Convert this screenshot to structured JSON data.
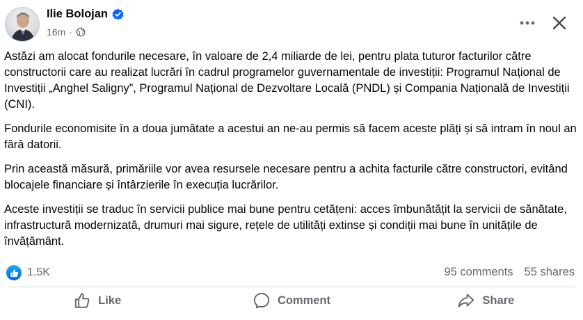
{
  "post": {
    "author": "Ilie Bolojan",
    "time": "16m",
    "icons": {
      "verified": "verified-badge-icon",
      "audience": "globe-icon",
      "more": "more-horizontal-icon",
      "close": "close-icon"
    },
    "paragraphs": [
      "Astăzi am alocat fondurile necesare, în valoare de 2,4 miliarde de lei, pentru plata tuturor facturilor către constructorii care au realizat lucrări în cadrul programelor guvernamentale de investiții: Programul Național de Investiții „Anghel Saligny”, Programul Național de Dezvoltare Locală (PNDL) și Compania Națională de Investiții (CNI).",
      "Fondurile economisite în a doua jumătate a acestui an ne-au permis să facem aceste plăți și să intram în noul an fără datorii.",
      "Prin această măsură, primăriile vor avea resursele necesare pentru a achita facturile către constructori, evitând blocajele financiare și întârzierile în execuția lucrărilor.",
      "Aceste investiții se traduc în servicii publice mai bune pentru cetățeni: acces îmbunătățit la servicii de sănătate, infrastructură modernizată, drumuri mai sigure, rețele de utilități extinse și condiții mai bune în unitățile de învățământ."
    ]
  },
  "stats": {
    "reactions": "1.5K",
    "comments": "95 comments",
    "shares": "55 shares"
  },
  "actions": {
    "like": "Like",
    "comment": "Comment",
    "share": "Share"
  },
  "colors": {
    "text": "#050505",
    "secondary": "#65676b",
    "accent": "#0866ff",
    "divider": "#ced0d4"
  }
}
